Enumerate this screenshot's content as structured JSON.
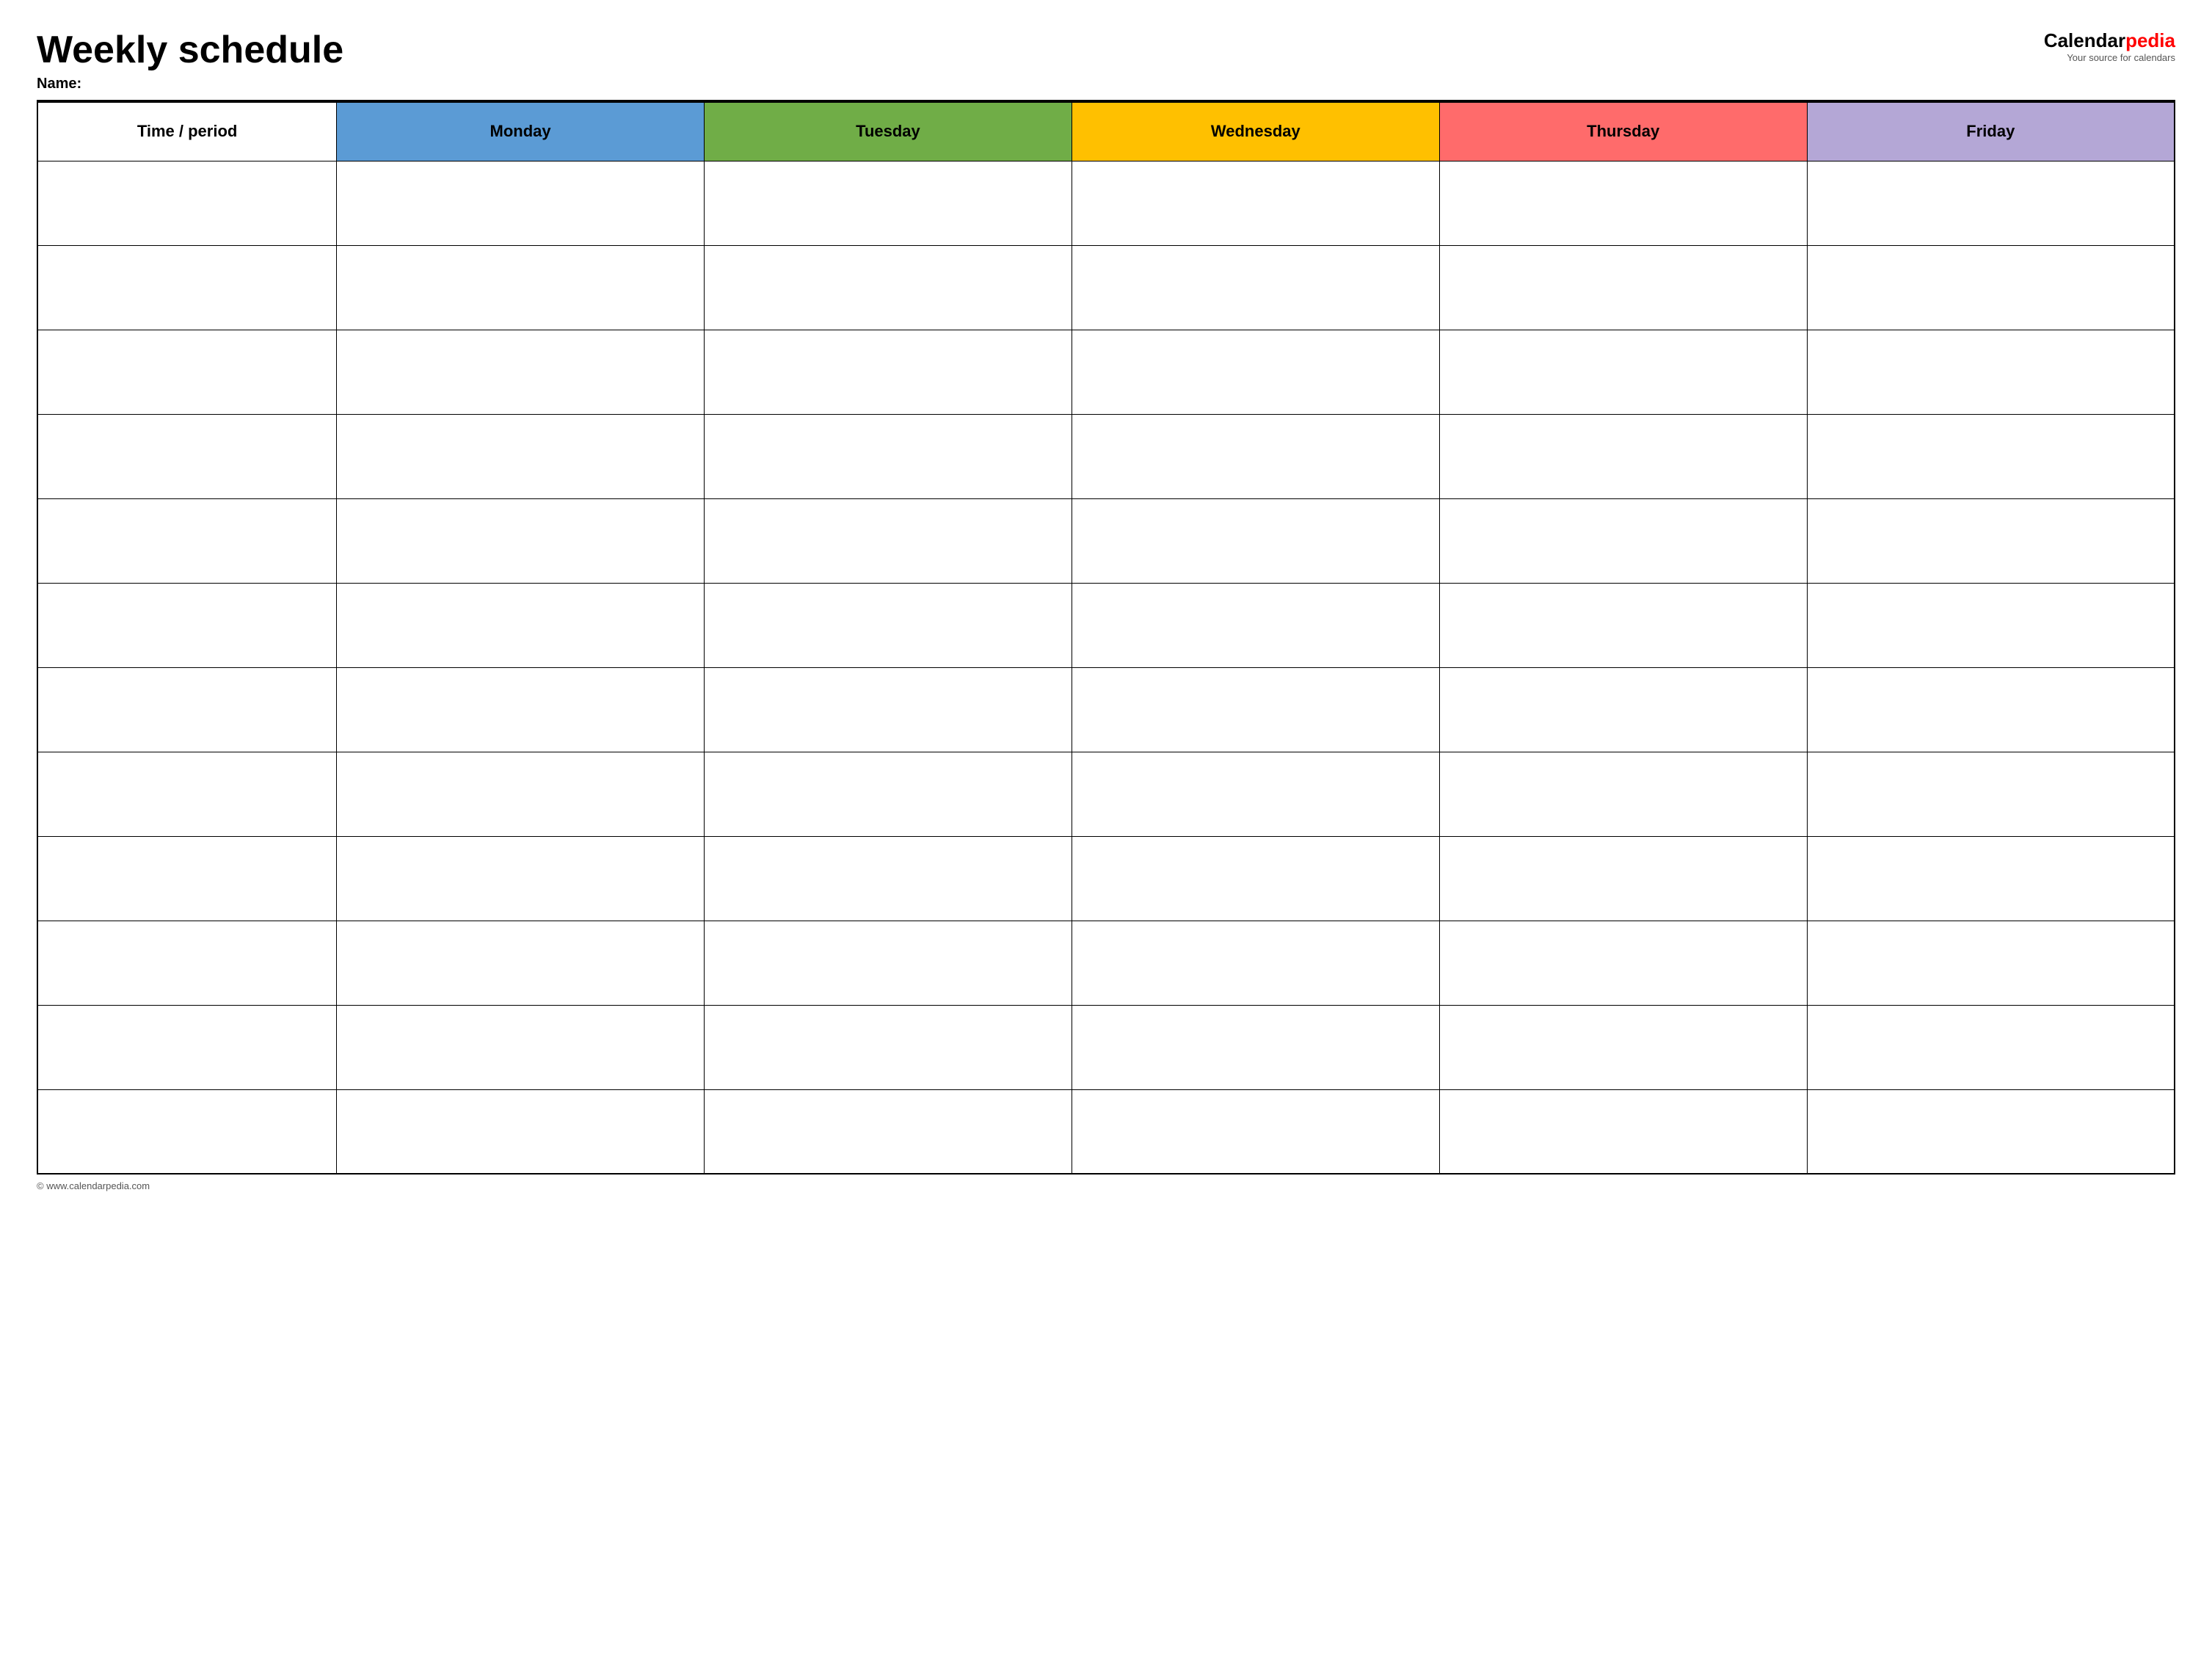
{
  "header": {
    "title": "Weekly schedule",
    "name_label": "Name:",
    "logo": {
      "calendar_part": "Calendar",
      "pedia_part": "pedia",
      "tagline": "Your source for calendars"
    }
  },
  "table": {
    "columns": [
      {
        "id": "time",
        "label": "Time / period",
        "color": "#ffffff"
      },
      {
        "id": "monday",
        "label": "Monday",
        "color": "#5b9bd5"
      },
      {
        "id": "tuesday",
        "label": "Tuesday",
        "color": "#70ad47"
      },
      {
        "id": "wednesday",
        "label": "Wednesday",
        "color": "#ffc000"
      },
      {
        "id": "thursday",
        "label": "Thursday",
        "color": "#ff6b6b"
      },
      {
        "id": "friday",
        "label": "Friday",
        "color": "#b4a7d6"
      }
    ],
    "row_count": 12
  },
  "footer": {
    "text": "© www.calendarpedia.com"
  }
}
